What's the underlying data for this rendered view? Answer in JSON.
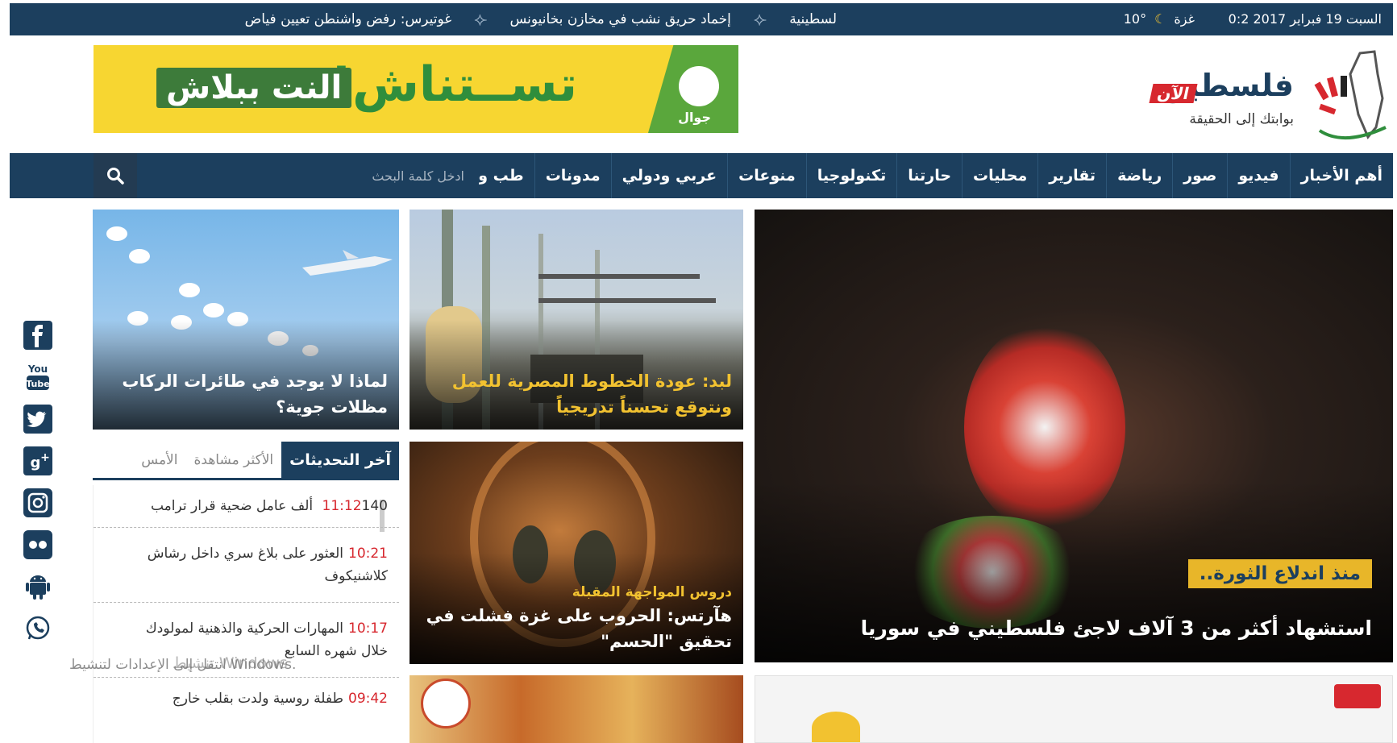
{
  "topbar": {
    "date": "السبت 19 فبراير 2017 0:2",
    "city": "غزة",
    "temperature": "10°",
    "ticker": [
      "لسطينية",
      "إخماد حريق نشب في مخازن بخانيونس",
      "غوتيرس: رفض واشنطن تعيين فياض"
    ]
  },
  "logo": {
    "title": "فلسطين",
    "badge": "الآن",
    "slogan": "بوابتك إلى الحقيقة"
  },
  "ad": {
    "main": "تســتناش!",
    "box": "النت ببلاش",
    "brand": "جوال"
  },
  "nav": {
    "items": [
      "أهم الأخبار",
      "فيديو",
      "صور",
      "رياضة",
      "تقارير",
      "محليات",
      "حارتنا",
      "تكنولوجيا",
      "منوعات",
      "عربي ودولي",
      "مدونات",
      "طب وصحة"
    ],
    "search_placeholder": "ادخل كلمة البحث"
  },
  "featured": {
    "label": "منذ اندلاع الثورة..",
    "title": "استشهاد أكثر من 3 آلاف لاجئ فلسطيني في سوريا"
  },
  "cards": {
    "c1": "لبد: عودة الخطوط المصرية للعمل ونتوقع تحسناً تدريجياً",
    "c2": "لماذا لا يوجد في طائرات الركاب مظلات جوية؟",
    "c3_kicker": "دروس المواجهة المقبلة",
    "c3": "هآرتس: الحروب على غزة فشلت في تحقيق \"الحسم\""
  },
  "tabs": [
    "آخر التحديثات",
    "الأكثر مشاهدة",
    "الأمس"
  ],
  "updates": [
    {
      "time": "11:12",
      "text": "140 ألف عامل ضحية قرار ترامب"
    },
    {
      "time": "10:21",
      "text": "العثور على بلاغ سري داخل رشاش كلاشنيكوف"
    },
    {
      "time": "10:17",
      "text": "المهارات الحركية والذهنية لمولودك خلال شهره السابع"
    },
    {
      "time": "09:42",
      "text": "طفلة روسية ولدت بقلب خارج"
    }
  ],
  "watermark": {
    "line1": "تنشيط Windows",
    "line2": "انتقل إلى الإعدادات لتنشيط Windows."
  },
  "social": [
    "facebook-icon",
    "youtube-icon",
    "twitter-icon",
    "google-plus-icon",
    "instagram-icon",
    "flickr-icon",
    "android-icon",
    "whatsapp-icon"
  ],
  "colors": {
    "primary": "#1c3f5e",
    "accent": "#d7282f",
    "highlight": "#e8b629"
  }
}
